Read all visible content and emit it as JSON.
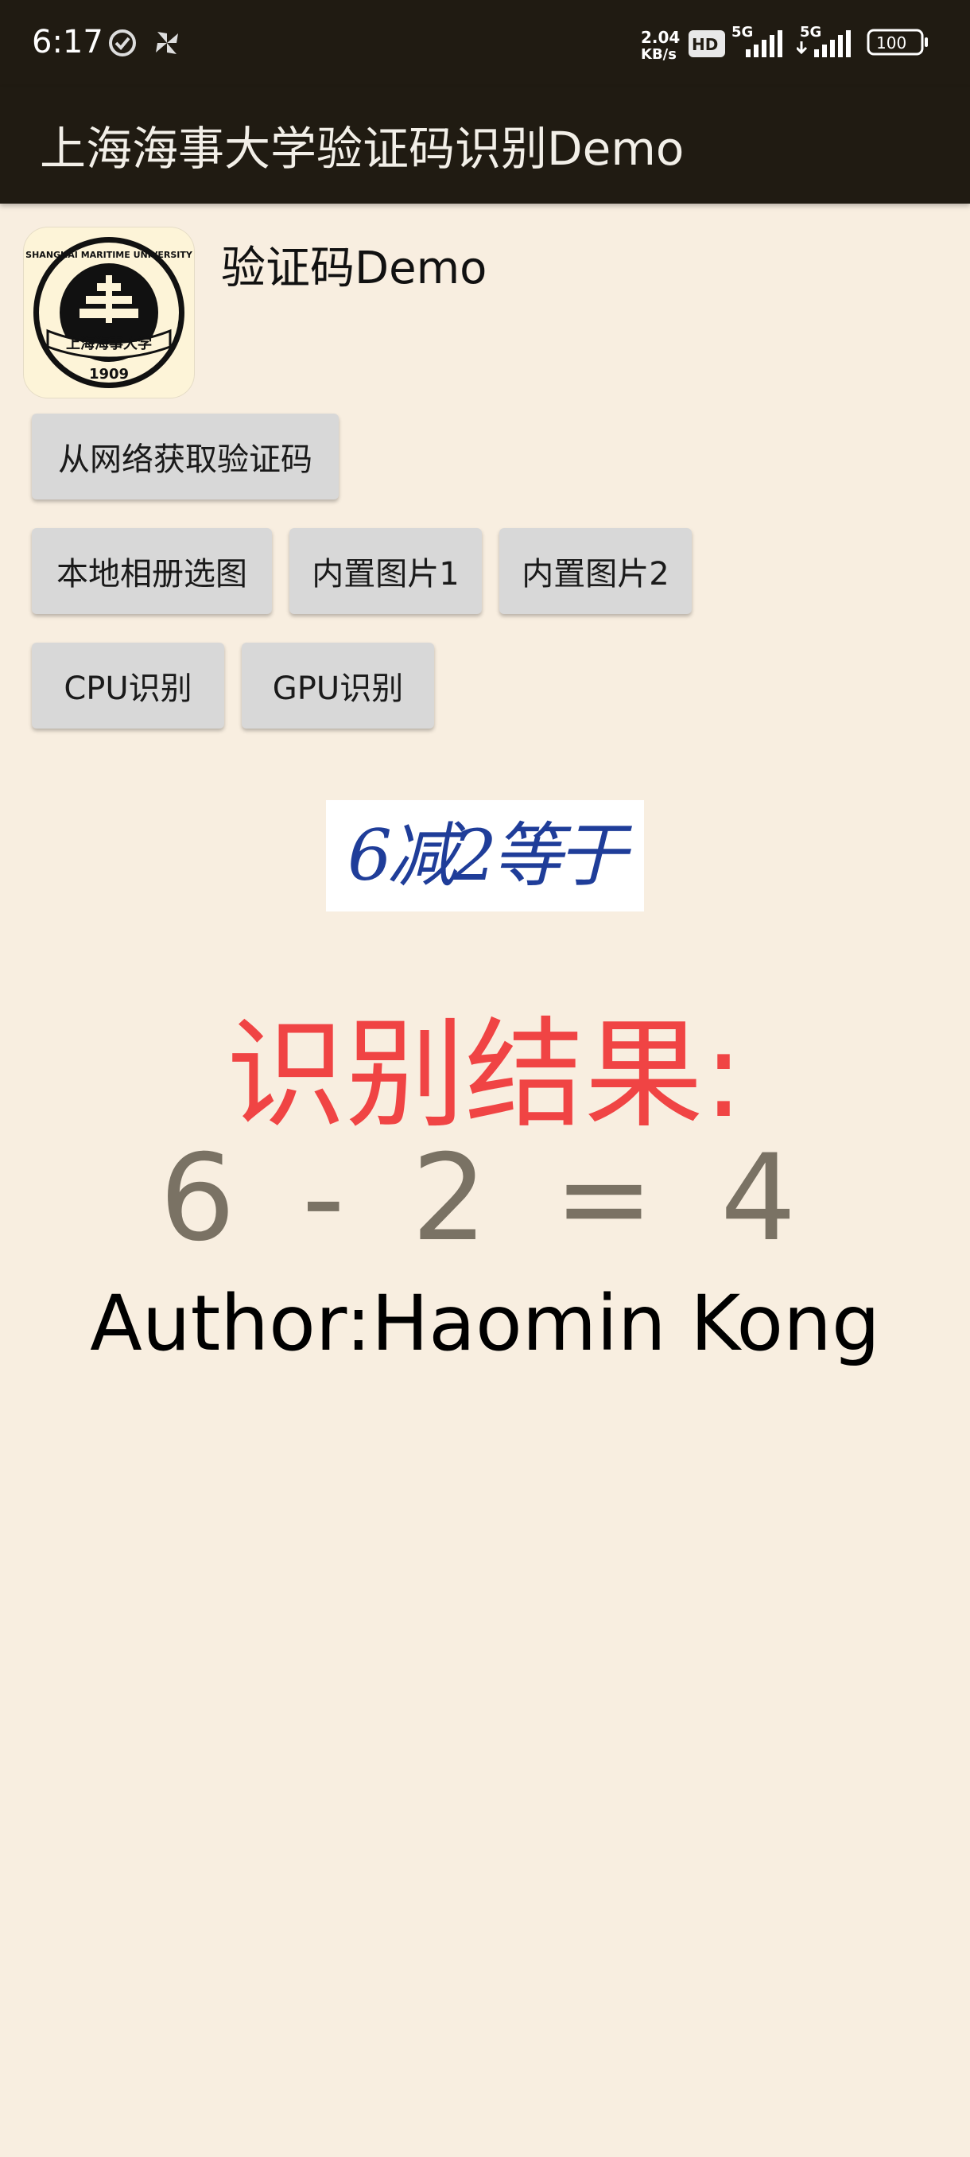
{
  "status_bar": {
    "time": "6:17",
    "net_speed_value": "2.04",
    "net_speed_unit": "KB/s",
    "hd_badge": "HD",
    "signal1_label": "5G",
    "signal2_label": "5G",
    "battery": "100",
    "icons": [
      "check-circle-icon",
      "pinwheel-icon",
      "signal-icon",
      "battery-icon"
    ]
  },
  "app_bar": {
    "title": "上海海事大学验证码识别Demo"
  },
  "header": {
    "label": "验证码Demo",
    "logo_text": {
      "ring": "SHANGHAI MARITIME UNIVERSITY",
      "banner": "上海海事大学",
      "year": "1909"
    }
  },
  "buttons": {
    "fetch": "从网络获取验证码",
    "album": "本地相册选图",
    "builtin1": "内置图片1",
    "builtin2": "内置图片2",
    "cpu": "CPU识别",
    "gpu": "GPU识别"
  },
  "captcha": {
    "text": "6减2等于"
  },
  "result": {
    "label": "识别结果:",
    "value": "6 - 2 = 4"
  },
  "author": "Author:Haomin Kong",
  "colors": {
    "bar": "#201b12",
    "background": "#f8eee0",
    "result_label": "#f04444",
    "result_value": "#7a7264",
    "button": "#d8d8d8",
    "captcha_ink": "#1f3d99"
  }
}
